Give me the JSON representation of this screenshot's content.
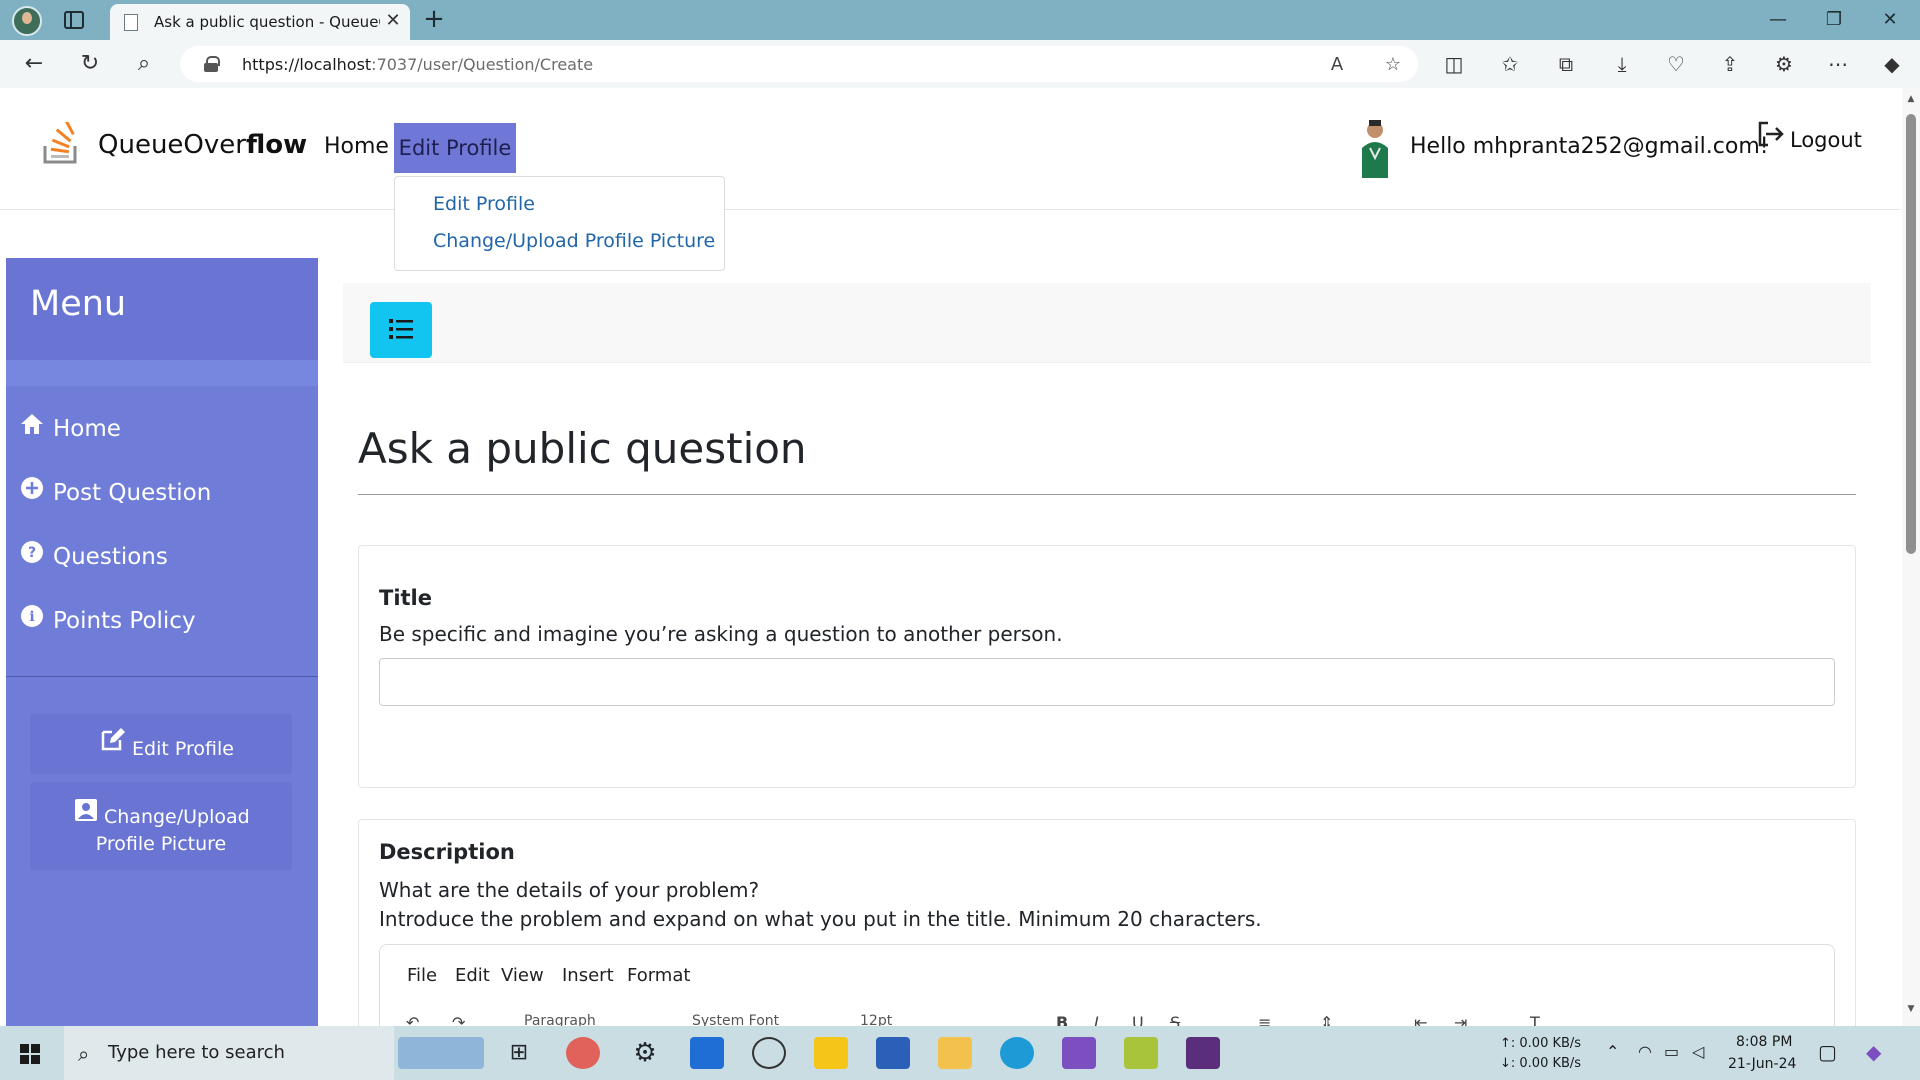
{
  "browser": {
    "tab_title": "Ask a public question - QueueOverflow",
    "url_host": "https://localhost",
    "url_path": ":7037/user/Question/Create"
  },
  "site": {
    "brand_prefix": "QueueOver",
    "brand_bold": "flow",
    "nav": {
      "home": "Home",
      "edit_profile": "Edit Profile"
    },
    "greeting": "Hello mhpranta252@gmail.com!",
    "logout": "Logout",
    "dropdown": {
      "edit_profile": "Edit Profile",
      "change_picture": "Change/Upload Profile Picture"
    }
  },
  "sidebar": {
    "title": "Menu",
    "items": [
      {
        "label": "Home",
        "icon": "home-icon"
      },
      {
        "label": "Post Question",
        "icon": "plus-circle-icon"
      },
      {
        "label": "Questions",
        "icon": "question-circle-icon"
      },
      {
        "label": "Points Policy",
        "icon": "info-circle-icon"
      }
    ],
    "buttons": {
      "edit_profile": "Edit Profile",
      "change_picture_line1": "Change/Upload",
      "change_picture_line2": "Profile Picture"
    }
  },
  "main": {
    "heading": "Ask a public question",
    "title_card": {
      "label": "Title",
      "hint": "Be specific and imagine you’re asking a question to another person.",
      "value": ""
    },
    "description_card": {
      "label": "Description",
      "hint1": "What are the details of your problem?",
      "hint2": "Introduce the problem and expand on what you put in the title. Minimum 20 characters.",
      "editor_menu": [
        "File",
        "Edit",
        "View",
        "Insert",
        "Format"
      ],
      "block_format": "Paragraph",
      "font_family": "System Font",
      "font_size": "12pt"
    }
  },
  "taskbar": {
    "search_placeholder": "Type here to search",
    "net_up": "↑: 0.00 KB/s",
    "net_down": "↓: 0.00 KB/s",
    "time": "8:08 PM",
    "date": "21-Jun-24"
  },
  "colors": {
    "sidebar": "#6f7dd8",
    "nav_active": "#6f78d6",
    "toggle_button": "#11c5f0",
    "link": "#2266aa"
  }
}
